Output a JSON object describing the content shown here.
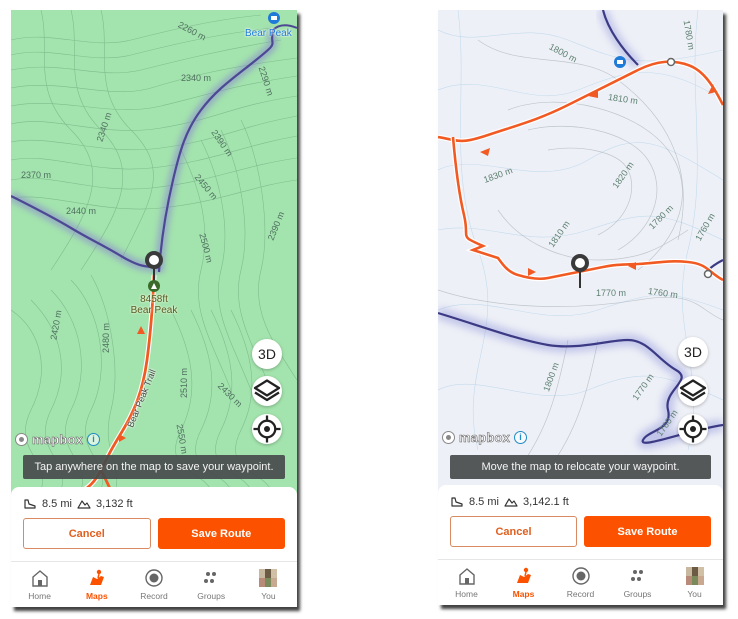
{
  "screens": {
    "left": {
      "map_style": "terrain-green",
      "contour_labels": [
        "2260 m",
        "2340 m",
        "2290 m",
        "2340 m",
        "2390 m",
        "2370 m",
        "2450 m",
        "2440 m",
        "2500 m",
        "2390 m",
        "2420 m",
        "2480 m",
        "2510 m",
        "2430 m",
        "2550 m"
      ],
      "poi_label": "Bear Peak",
      "peak": {
        "elevation": "8458ft",
        "name": "Bear Peak"
      },
      "trail_label": "Bear Peak Trail",
      "map_buttons": {
        "three_d": "3D"
      },
      "attribution": {
        "logo_text": "mapbox",
        "info": "i"
      },
      "toast": "Tap anywhere on the map to save your waypoint.",
      "stats": {
        "distance": "8.5 mi",
        "elevation_gain": "3,132 ft"
      },
      "actions": {
        "cancel": "Cancel",
        "save": "Save Route"
      }
    },
    "right": {
      "map_style": "winter-heatmap",
      "contour_labels": [
        "1800 m",
        "1780 m",
        "1810 m",
        "1830 m",
        "1820 m",
        "1810 m",
        "1780 m",
        "1760 m",
        "1770 m",
        "1760 m",
        "1800 m",
        "1770 m",
        "1760 m"
      ],
      "map_buttons": {
        "three_d": "3D"
      },
      "attribution": {
        "logo_text": "mapbox",
        "info": "i"
      },
      "toast": "Move the map to relocate your waypoint.",
      "stats": {
        "distance": "8.5 mi",
        "elevation_gain": "3,142.1 ft"
      },
      "actions": {
        "cancel": "Cancel",
        "save": "Save Route"
      }
    }
  },
  "tabbar": {
    "items": [
      {
        "label": "Home",
        "icon": "home-icon",
        "active": false
      },
      {
        "label": "Maps",
        "icon": "maps-icon",
        "active": true
      },
      {
        "label": "Record",
        "icon": "record-icon",
        "active": false
      },
      {
        "label": "Groups",
        "icon": "groups-icon",
        "active": false
      },
      {
        "label": "You",
        "icon": "avatar",
        "active": false
      }
    ]
  },
  "colors": {
    "brand_orange": "#fc5200",
    "route_orange": "#f15a22",
    "terrain_green": "#9be0a6",
    "winter_bg": "#eef0f7",
    "ski_track_purple": "#4a4690",
    "poi_blue": "#1f7ad8"
  }
}
